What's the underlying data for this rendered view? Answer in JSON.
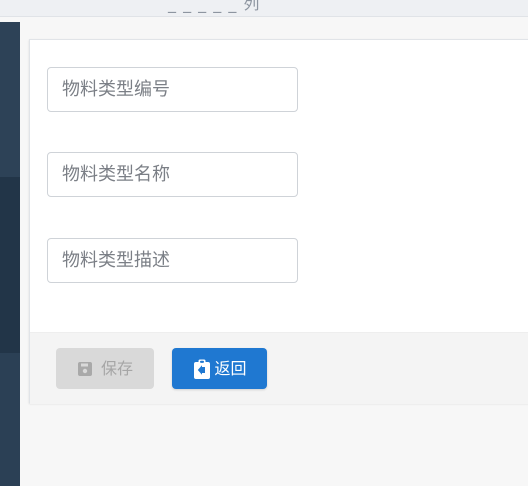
{
  "top_strip": {
    "partial_title": "_ _ _ _ _ 列"
  },
  "form": {
    "fields": [
      {
        "placeholder": "物料类型编号",
        "value": ""
      },
      {
        "placeholder": "物料类型名称",
        "value": ""
      },
      {
        "placeholder": "物料类型描述",
        "value": ""
      }
    ]
  },
  "footer": {
    "save_label": "保存",
    "back_label": "返回"
  },
  "icons": {
    "save": "save-icon",
    "back": "clipboard-back-icon"
  },
  "colors": {
    "primary": "#1f78d1",
    "disabled_bg": "#d9d9d9",
    "disabled_text": "#a6a6a6",
    "sidebar": "#2d4257"
  }
}
